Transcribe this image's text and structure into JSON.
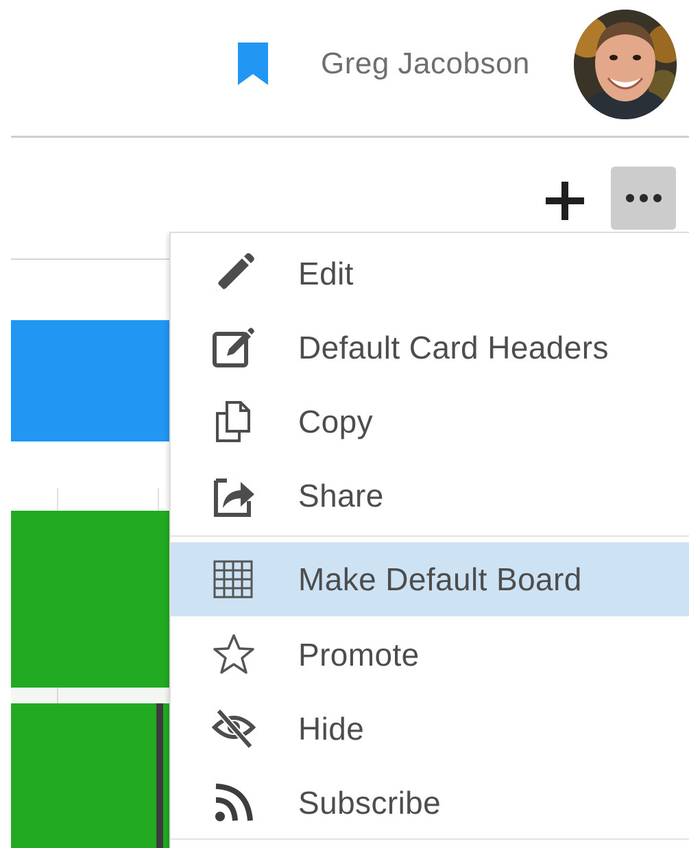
{
  "header": {
    "user_name": "Greg Jacobson",
    "icons": {
      "bookmark": "bookmark-icon",
      "avatar": "user-avatar"
    }
  },
  "toolbar": {
    "add_icon": "plus-icon",
    "more_icon": "ellipsis-icon"
  },
  "menu": {
    "items": [
      {
        "label": "Edit",
        "icon": "pencil-icon"
      },
      {
        "label": "Default Card Headers",
        "icon": "edit-square-icon"
      },
      {
        "label": "Copy",
        "icon": "copy-icon"
      },
      {
        "label": "Share",
        "icon": "share-icon"
      },
      {
        "label": "Make Default Board",
        "icon": "grid-icon",
        "highlighted": true
      },
      {
        "label": "Promote",
        "icon": "star-icon"
      },
      {
        "label": "Hide",
        "icon": "eye-slash-icon"
      },
      {
        "label": "Subscribe",
        "icon": "rss-icon"
      }
    ]
  },
  "colors": {
    "accent_blue": "#2196f3",
    "board_green": "#22aa22",
    "menu_highlight": "#cde3f3",
    "more_button_bg": "#cccccc"
  }
}
